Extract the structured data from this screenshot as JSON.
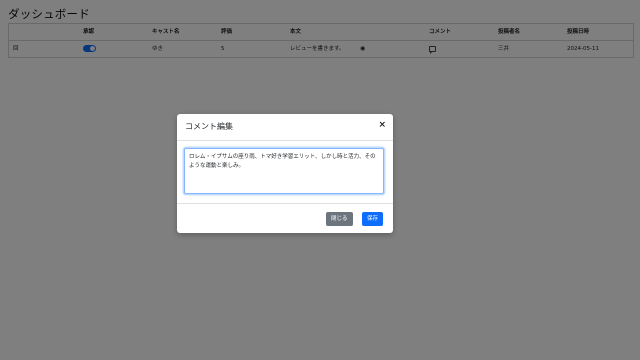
{
  "page": {
    "title": "ダッシュボード"
  },
  "table": {
    "headers": {
      "approve": "承認",
      "cast_name": "キャスト名",
      "rating": "評価",
      "body": "本文",
      "comment": "コメント",
      "poster": "投稿者名",
      "date": "投稿日時"
    },
    "rows": [
      {
        "id": "回",
        "approved": true,
        "cast_name": "ゆき",
        "rating": "5",
        "body": "レビューを書きます。",
        "poster": "三井",
        "date": "2024-05-11"
      }
    ],
    "icons": {
      "toggle": "toggle-switch-on",
      "preview": "eye-icon",
      "comment": "chat-icon"
    }
  },
  "modal": {
    "title": "コメント編集",
    "close_symbol": "×",
    "textarea_value": "ロレム・イプサムの座り雨、トマ好き学習エリット、しかし時と活力、そのような運動と楽しみ。",
    "cancel_label": "閉じる",
    "save_label": "保存"
  },
  "colors": {
    "primary": "#0d6efd",
    "secondary": "#6c757d",
    "backdrop": "rgba(0,0,0,0.5)"
  }
}
